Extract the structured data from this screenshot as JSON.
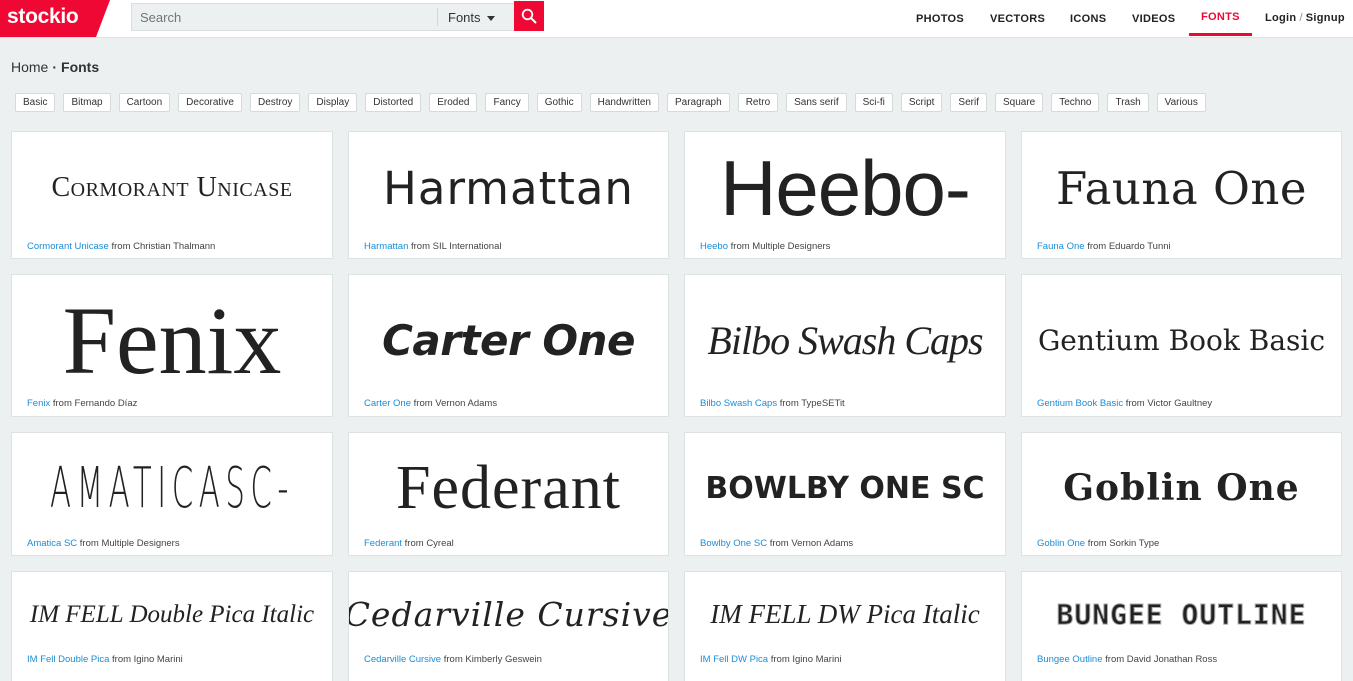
{
  "brand": {
    "name": "stockio",
    "color": "#ef0833"
  },
  "search": {
    "placeholder": "Search",
    "value": "",
    "type_selected": "Fonts",
    "button_icon": "search-icon"
  },
  "nav": {
    "items": [
      {
        "label": "PHOTOS",
        "active": false
      },
      {
        "label": "VECTORS",
        "active": false
      },
      {
        "label": "ICONS",
        "active": false
      },
      {
        "label": "VIDEOS",
        "active": false
      },
      {
        "label": "FONTS",
        "active": true
      }
    ],
    "login": "Login",
    "separator": "/",
    "signup": "Signup"
  },
  "breadcrumb": {
    "home": "Home",
    "separator": "·",
    "current": "Fonts"
  },
  "tags": [
    "Basic",
    "Bitmap",
    "Cartoon",
    "Decorative",
    "Destroy",
    "Display",
    "Distorted",
    "Eroded",
    "Fancy",
    "Gothic",
    "Handwritten",
    "Paragraph",
    "Retro",
    "Sans serif",
    "Sci-fi",
    "Script",
    "Serif",
    "Square",
    "Techno",
    "Trash",
    "Various"
  ],
  "fonts": [
    {
      "preview": "Cormorant Unicase",
      "name": "Cormorant Unicase",
      "from": "from",
      "author": "Christian Thalmann"
    },
    {
      "preview": "Harmattan",
      "name": "Harmattan",
      "from": "from",
      "author": "SIL International"
    },
    {
      "preview": "Heebo-",
      "name": "Heebo",
      "from": "from",
      "author": "Multiple Designers"
    },
    {
      "preview": "Fauna One",
      "name": "Fauna One",
      "from": "from",
      "author": "Eduardo Tunni"
    },
    {
      "preview": "Fenix",
      "name": "Fenix",
      "from": "from",
      "author": "Fernando Díaz"
    },
    {
      "preview": "Carter One",
      "name": "Carter One",
      "from": "from",
      "author": "Vernon Adams"
    },
    {
      "preview": "Bilbo Swash Caps",
      "name": "Bilbo Swash Caps",
      "from": "from",
      "author": "TypeSETit"
    },
    {
      "preview": "Gentium Book Basic",
      "name": "Gentium Book Basic",
      "from": "from",
      "author": "Victor Gaultney"
    },
    {
      "preview": "AMATICASC-",
      "name": "Amatica SC",
      "from": "from",
      "author": "Multiple Designers"
    },
    {
      "preview": "Federant",
      "name": "Federant",
      "from": "from",
      "author": "Cyreal"
    },
    {
      "preview": "BOWLBY ONE SC",
      "name": "Bowlby One SC",
      "from": "from",
      "author": "Vernon Adams"
    },
    {
      "preview": "Goblin One",
      "name": "Goblin One",
      "from": "from",
      "author": "Sorkin Type"
    },
    {
      "preview": "IM FELL Double Pica Italic",
      "name": "IM Fell Double Pica",
      "from": "from",
      "author": "Igino Marini"
    },
    {
      "preview": "Cedarville Cursive",
      "name": "Cedarville Cursive",
      "from": "from",
      "author": "Kimberly Geswein"
    },
    {
      "preview": "IM FELL DW Pica Italic",
      "name": "IM Fell DW Pica",
      "from": "from",
      "author": "Igino Marini"
    },
    {
      "preview": "BUNGEE OUTLINE",
      "name": "Bungee Outline",
      "from": "from",
      "author": "David Jonathan Ross"
    }
  ],
  "colors": {
    "accent": "#ef0833",
    "link": "#1a8dd8",
    "background": "#ecf0f0"
  }
}
